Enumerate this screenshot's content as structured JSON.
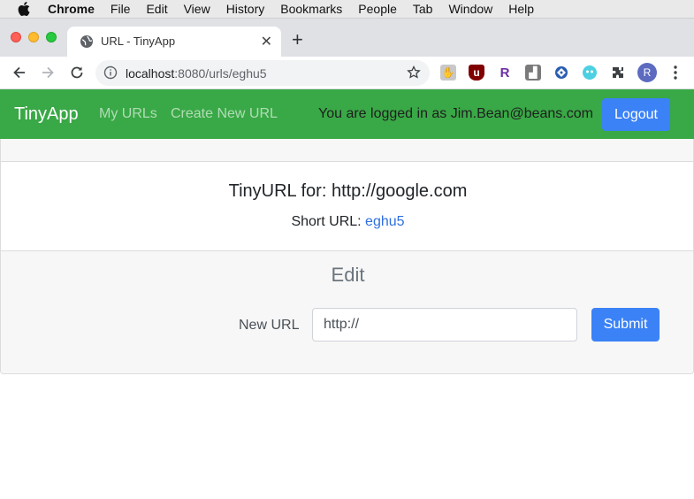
{
  "menubar": {
    "app": "Chrome",
    "items": [
      "File",
      "Edit",
      "View",
      "History",
      "Bookmarks",
      "People",
      "Tab",
      "Window",
      "Help"
    ]
  },
  "tab": {
    "title": "URL - TinyApp",
    "close": "✕"
  },
  "toolbar": {
    "url_host": "localhost",
    "url_rest": ":8080/urls/eghu5",
    "avatar_letter": "R"
  },
  "navbar": {
    "brand": "TinyApp",
    "links": [
      "My URLs",
      "Create New URL"
    ],
    "logged_in_text": "You are logged in as Jim.Bean@beans.com",
    "logout_label": "Logout"
  },
  "card": {
    "title": "TinyURL for: http://google.com",
    "short_label": "Short URL: ",
    "short_value": "eghu5"
  },
  "edit": {
    "heading": "Edit",
    "label": "New URL",
    "input_value": "http://",
    "submit_label": "Submit"
  },
  "colors": {
    "navbar_green": "#39a846",
    "button_blue": "#3b82f6",
    "link_blue": "#2f6fe0"
  }
}
